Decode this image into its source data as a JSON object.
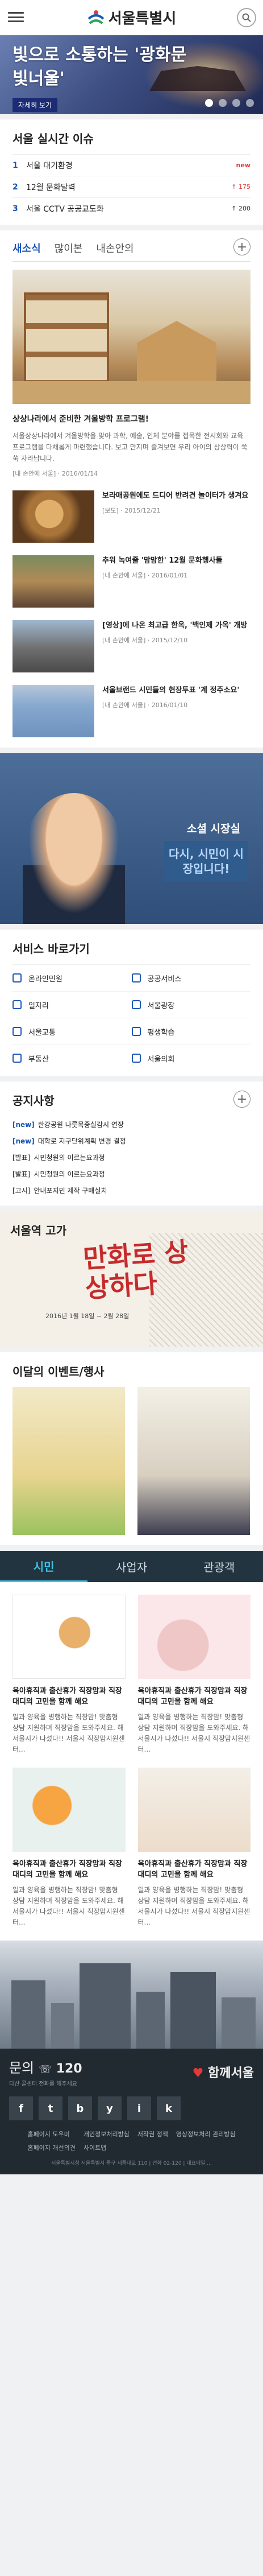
{
  "header": {
    "logo_text": "서울특별시"
  },
  "hero": {
    "title": "빛으로 소통하는 '광화문 빛너울'",
    "tag": "자세히 보기"
  },
  "issues": {
    "title": "서울 실시간 이슈",
    "items": [
      {
        "rank": "1",
        "text": "서울 대기환경",
        "badge": "new",
        "badge_type": "new"
      },
      {
        "rank": "2",
        "text": "12월 문화달력",
        "badge": "↑ 175",
        "badge_type": "up"
      },
      {
        "rank": "3",
        "text": "서울 CCTV 공공교도화",
        "badge": "↑ 200",
        "badge_type": "down"
      }
    ]
  },
  "news": {
    "tabs": [
      "새소식",
      "많이본",
      "내손안의"
    ],
    "main": {
      "title": "상상나라에서 준비한 겨울방학 프로그램!",
      "desc": "서울상상나라에서 겨울방학을 맞아 과학, 예술, 인체 분야를 접목한 전시회와 교육 프로그램을 다채롭게 마련했습니다. 보고 만지며 즐겨보면 우리 아이의 상상력이 쑥쑥 자라납니다.",
      "meta": "[내 손안에 서울] · 2016/01/14"
    },
    "items": [
      {
        "title": "보라매공원에도 드디어 반려견 놀이터가 생겨요",
        "meta": "[보도] · 2015/12/21"
      },
      {
        "title": "추워 녹여줄 '맘맘한' 12월 문화행사들",
        "meta": "[내 손안에 서울] · 2016/01/01"
      },
      {
        "title": "[영상]에 나온 최고급 한옥, '백인제 가옥' 개방",
        "meta": "[내 손안에 서울] · 2015/12/10"
      },
      {
        "title": "서울브랜드 시민들의 현장투표 '계 정주소요'",
        "meta": "[내 손안에 서울] · 2016/01/10"
      }
    ]
  },
  "mayor": {
    "label": "소셜 시장실",
    "bubble": "다시, 시민이 시장입니다!"
  },
  "services": {
    "title": "서비스 바로가기",
    "items": [
      "온라인민원",
      "공공서비스",
      "일자리",
      "서울광장",
      "서울교통",
      "평생학습",
      "부동산",
      "서울의회"
    ]
  },
  "notices": {
    "title": "공지사항",
    "items": [
      {
        "prefix": "[new]",
        "text": "한강공원 나룻목중실감시 연장"
      },
      {
        "prefix": "[new]",
        "text": "대학로 지구단위계획 변경 결정"
      },
      {
        "prefix": "[발표]",
        "text": "시민청원의 이르는요과정"
      },
      {
        "prefix": "[발표]",
        "text": "시민청원의 이르는요과정"
      },
      {
        "prefix": "[고시]",
        "text": "안내포지민 제작 구매실치"
      }
    ]
  },
  "expo": {
    "subtitle": "서울역 고가",
    "title": "만화로 상상하다",
    "date": "2016년 1월 18일 ~ 2월 28일"
  },
  "events": {
    "title": "이달의 이벤트/행사"
  },
  "audience": {
    "tabs": [
      "시민",
      "사업자",
      "관광객"
    ],
    "cards": [
      {
        "title": "육아휴직과 출산휴가 직장맘과 직장대디의 고민을 함께 해요",
        "desc": "일과 양육을 병행하는 직장맘! 맞춤형 상담 지원하며 직장맘을 도와주세요. 해서울시가 나섰다!! 서울시 직장맘지원센터..."
      },
      {
        "title": "육아휴직과 출산휴가 직장맘과 직장대디의 고민을 함께 해요",
        "desc": "일과 양육을 병행하는 직장맘! 맞춤형 상담 지원하며 직장맘을 도와주세요. 해서울시가 나섰다!! 서울시 직장맘지원센터..."
      },
      {
        "title": "육아휴직과 출산휴가 직장맘과 직장대디의 고민을 함께 해요",
        "desc": "일과 양육을 병행하는 직장맘! 맞춤형 상담 지원하며 직장맘을 도와주세요. 해서울시가 나섰다!! 서울시 직장맘지원센터..."
      },
      {
        "title": "육아휴직과 출산휴가 직장맘과 직장대디의 고민을 함께 해요",
        "desc": "일과 양육을 병행하는 직장맘! 맞춤형 상담 지원하며 직장맘을 도와주세요. 해서울시가 나섰다!! 서울시 직장맘지원센터..."
      }
    ]
  },
  "footer": {
    "contact_label": "문의",
    "contact_number": "120",
    "contact_sub": "다산 콜센터 전화를 해주세요",
    "with_seoul": "함께서울",
    "social": [
      "f",
      "t",
      "b",
      "y",
      "i",
      "k"
    ],
    "links": [
      "홈페이지 도우미",
      "개인정보처리방침",
      "저작권 정책",
      "영상정보처리 관리방침",
      "홈페이지 개선의견",
      "사이트맵"
    ],
    "copyright": "서울특별시청 서울특별시 중구 세종대로 110 | 전화 02-120 | 대표메일 ..."
  },
  "colors": {
    "primary": "#1b57b8",
    "accent": "#3fc1e6",
    "footer_bg": "#222a31"
  }
}
